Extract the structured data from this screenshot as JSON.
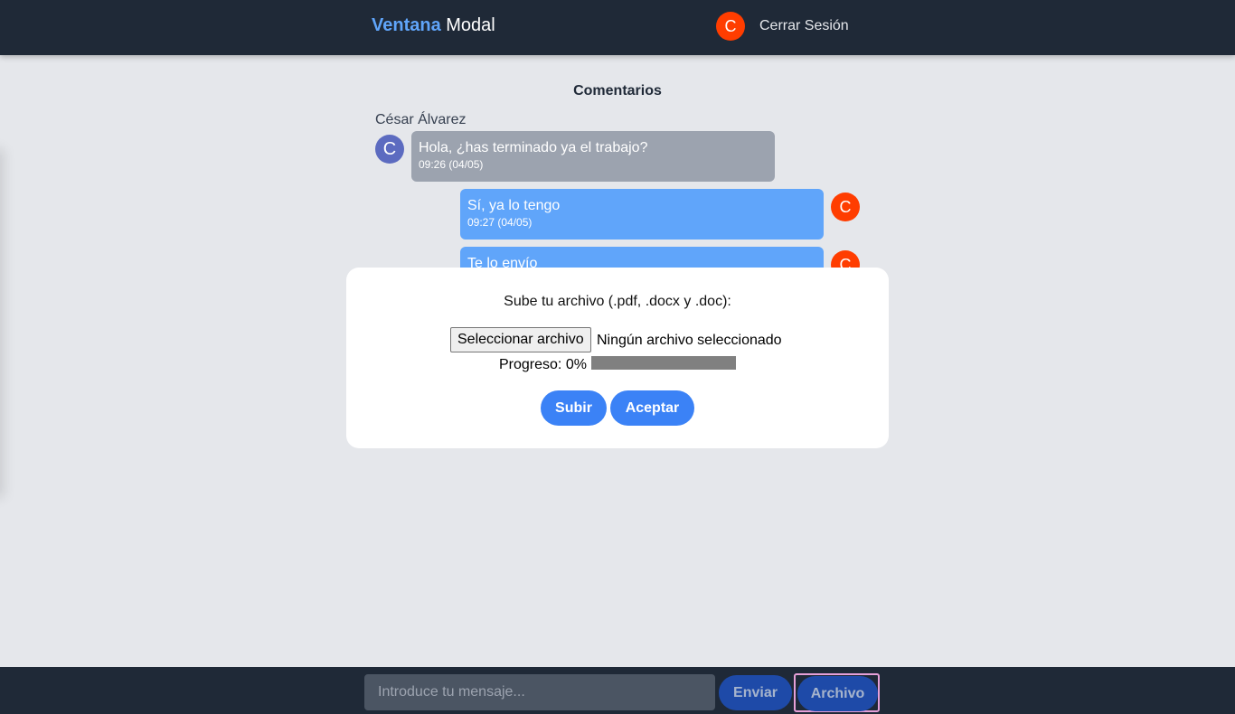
{
  "header": {
    "brand_part1": "Ventana",
    "brand_part2": "Modal",
    "user_initial": "C",
    "logout_label": "Cerrar Sesión"
  },
  "comments": {
    "title": "Comentarios",
    "sender_name": "César Álvarez",
    "messages": [
      {
        "side": "left",
        "avatar": "C",
        "text": "Hola, ¿has terminado ya el trabajo?",
        "time": "09:26 (04/05)"
      },
      {
        "side": "right",
        "avatar": "C",
        "text": "Sí, ya lo tengo",
        "time": "09:27 (04/05)"
      },
      {
        "side": "right",
        "avatar": "C",
        "text": "Te lo envío"
      }
    ]
  },
  "modal": {
    "title": "Sube tu archivo (.pdf, .docx y .doc):",
    "file_button": "Seleccionar archivo",
    "file_status": "Ningún archivo seleccionado",
    "progress_label": "Progreso: 0%",
    "progress_value": 0,
    "upload_button": "Subir",
    "accept_button": "Aceptar"
  },
  "footer": {
    "input_placeholder": "Introduce tu mensaje...",
    "send_button": "Enviar",
    "file_button": "Archivo"
  },
  "colors": {
    "header_bg": "#1f2937",
    "accent_blue": "#3b82f6",
    "brand_blue": "#60a5fa",
    "avatar_orange": "#ff3d00",
    "avatar_purple": "#5c6bc0",
    "bubble_gray": "#9ca3af",
    "bubble_blue": "#60a5fa"
  }
}
